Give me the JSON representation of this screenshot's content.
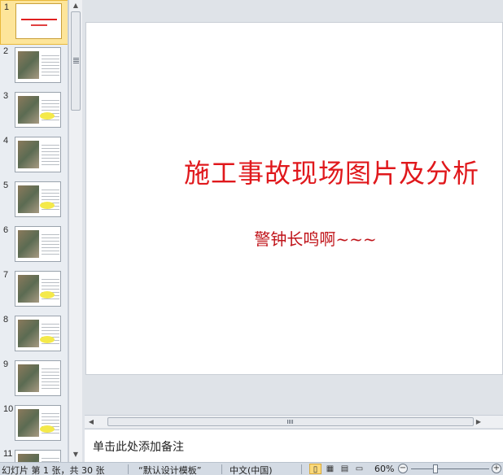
{
  "thumbnails": [
    {
      "number": "1"
    },
    {
      "number": "2"
    },
    {
      "number": "3"
    },
    {
      "number": "4"
    },
    {
      "number": "5"
    },
    {
      "number": "6"
    },
    {
      "number": "7"
    },
    {
      "number": "8"
    },
    {
      "number": "9"
    },
    {
      "number": "10"
    },
    {
      "number": "11"
    }
  ],
  "selected_slide_index": 1,
  "slide": {
    "title": "施工事故现场图片及分析",
    "subtitle": "警钟长鸣啊~~~"
  },
  "notes": {
    "placeholder": "单击此处添加备注"
  },
  "status": {
    "slide_info": "幻灯片 第 1 张，共 30 张",
    "theme": "“默认设计模板”",
    "language": "中文(中国)",
    "zoom": "60%"
  },
  "colors": {
    "title_red": "#e0181c",
    "selection_bg": "#fde59a"
  }
}
